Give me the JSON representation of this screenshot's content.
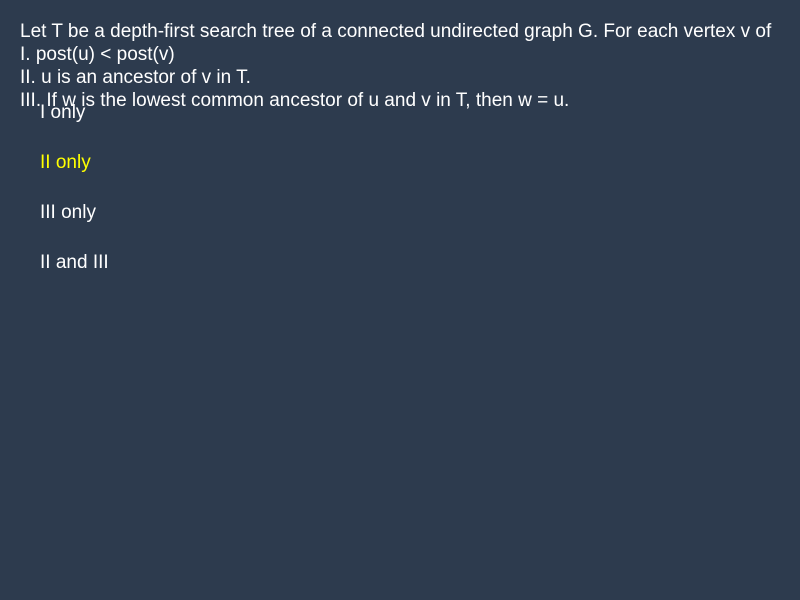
{
  "question": {
    "stem": "Let T be a depth-first search tree of a connected undirected graph G. For each vertex v of",
    "statements": [
      "I. post(u) < post(v)",
      "II. u is an ancestor of v in T.",
      "III. If w is the lowest common ancestor of u and v in T, then w = u."
    ]
  },
  "options": [
    {
      "label": "I only",
      "selected": false
    },
    {
      "label": "II only",
      "selected": true
    },
    {
      "label": "III only",
      "selected": false
    },
    {
      "label": "II and III",
      "selected": false
    }
  ],
  "colors": {
    "background": "#2d3b4e",
    "text": "#ffffff",
    "selected": "#ffff00"
  }
}
